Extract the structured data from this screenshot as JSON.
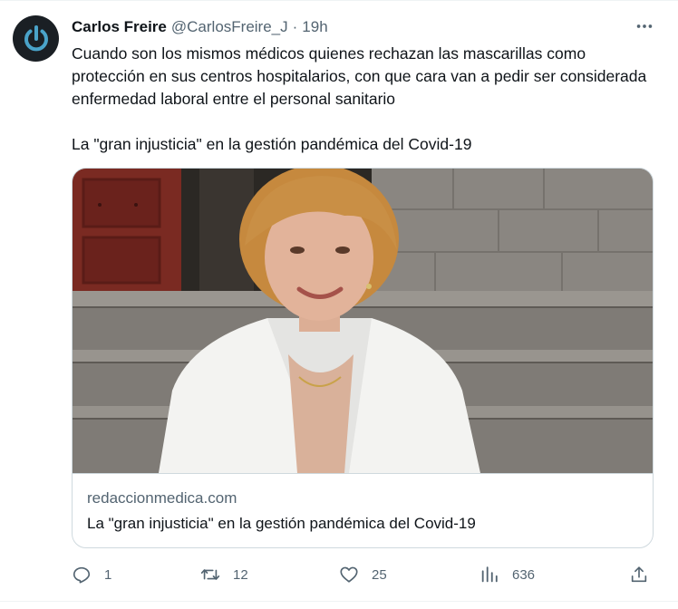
{
  "tweet": {
    "author": {
      "name": "Carlos Freire",
      "handle": "@CarlosFreire_J",
      "avatar_icon": "power-icon",
      "avatar_bg": "#1a1f24",
      "avatar_fg": "#4aa3c9"
    },
    "separator": "·",
    "time": "19h",
    "more_icon": "more-horizontal-icon",
    "text_paragraphs": [
      "Cuando son los mismos médicos quienes rechazan las mascarillas como protección en sus centros hospitalarios, con que cara van a pedir ser considerada enfermedad laboral entre el personal sanitario",
      "La \"gran injusticia\" en la gestión pandémica del Covid-19"
    ],
    "card": {
      "domain": "redaccionmedica.com",
      "title": "La \"gran injusticia\" en la gestión pandémica del Covid-19"
    },
    "actions": {
      "reply": {
        "icon": "reply-icon",
        "count": "1"
      },
      "retweet": {
        "icon": "retweet-icon",
        "count": "12"
      },
      "like": {
        "icon": "heart-icon",
        "count": "25"
      },
      "views": {
        "icon": "analytics-icon",
        "count": "636"
      },
      "share": {
        "icon": "share-icon"
      }
    },
    "colors": {
      "text": "#0f1419",
      "secondary": "#536471",
      "border": "#cfd9de"
    }
  }
}
